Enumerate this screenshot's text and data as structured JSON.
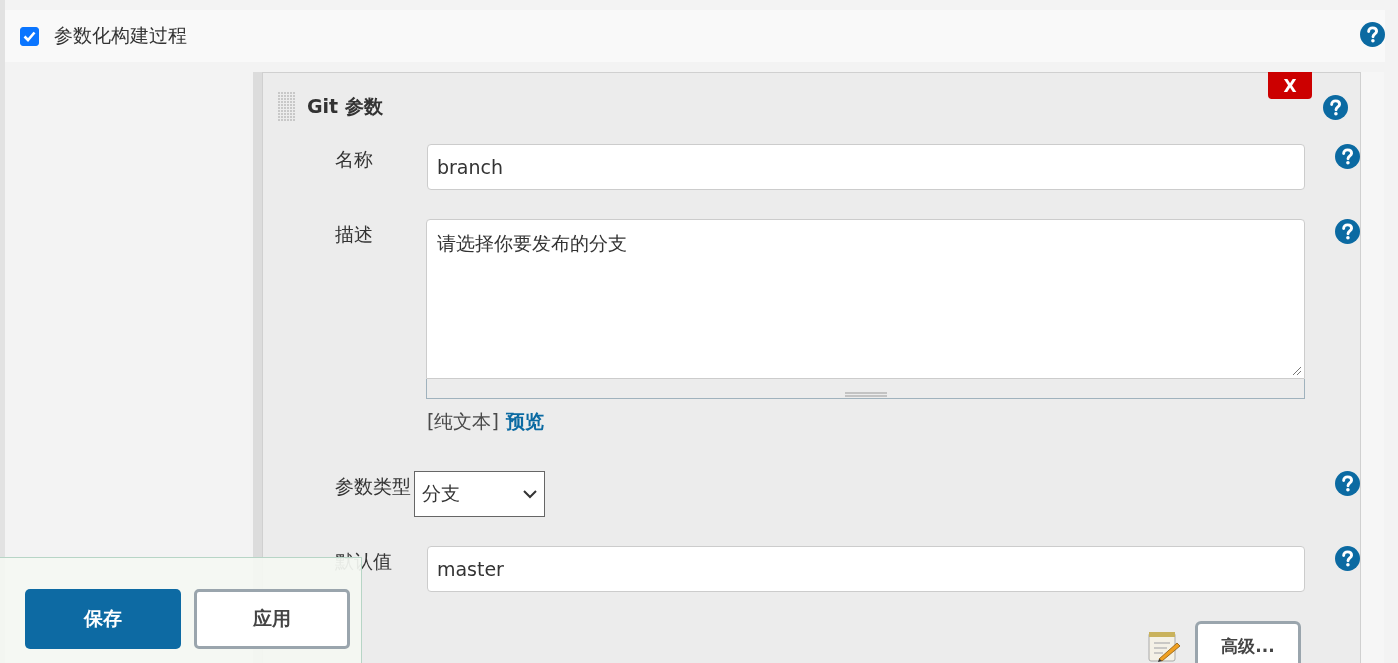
{
  "build_option": {
    "label": "参数化构建过程",
    "checked": true
  },
  "parameter": {
    "title": "Git 参数",
    "delete_label": "X",
    "fields": [
      {
        "kind": "text",
        "label": "名称",
        "value": "branch"
      },
      {
        "kind": "textarea",
        "label": "描述",
        "value": "请选择你要发布的分支",
        "format": "[纯文本]",
        "preview_link": "预览"
      },
      {
        "kind": "select",
        "label": "参数类型",
        "value": "分支"
      },
      {
        "kind": "text",
        "label": "默认值",
        "value": "master"
      }
    ],
    "advanced_button": "高级..."
  },
  "footer": {
    "buttons": [
      {
        "label": "保存",
        "kind": "primary"
      },
      {
        "label": "应用",
        "kind": "secondary"
      }
    ]
  }
}
